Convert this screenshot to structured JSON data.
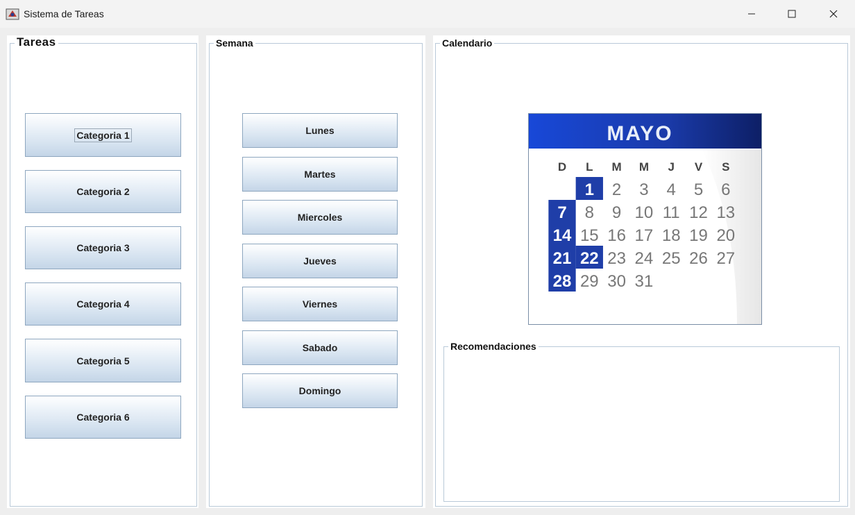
{
  "window": {
    "title": "Sistema de Tareas",
    "controls": [
      "minimize",
      "maximize",
      "close"
    ]
  },
  "tareas": {
    "legend": "Tareas",
    "buttons": [
      "Categoria 1",
      "Categoria 2",
      "Categoria 3",
      "Categoria 4",
      "Categoria 5",
      "Categoria 6"
    ]
  },
  "semana": {
    "legend": "Semana",
    "buttons": [
      "Lunes",
      "Martes",
      "Miercoles",
      "Jueves",
      "Viernes",
      "Sabado",
      "Domingo"
    ]
  },
  "calendario": {
    "legend": "Calendario",
    "image": {
      "month": "MAYO",
      "weekdays": [
        "D",
        "L",
        "M",
        "M",
        "J",
        "V",
        "S"
      ],
      "weeks": [
        [
          "",
          "1",
          "2",
          "3",
          "4",
          "5",
          "6"
        ],
        [
          "7",
          "8",
          "9",
          "10",
          "11",
          "12",
          "13"
        ],
        [
          "14",
          "15",
          "16",
          "17",
          "18",
          "19",
          "20"
        ],
        [
          "21",
          "22",
          "23",
          "24",
          "25",
          "26",
          "27"
        ],
        [
          "28",
          "29",
          "30",
          "31",
          "",
          "",
          ""
        ]
      ],
      "highlighted_days": [
        "1",
        "7",
        "14",
        "21",
        "22",
        "28"
      ],
      "header_color": "#1a3fb0",
      "highlight_color": "#1f3ea8"
    }
  },
  "recomendaciones": {
    "legend": "Recomendaciones",
    "content": ""
  }
}
